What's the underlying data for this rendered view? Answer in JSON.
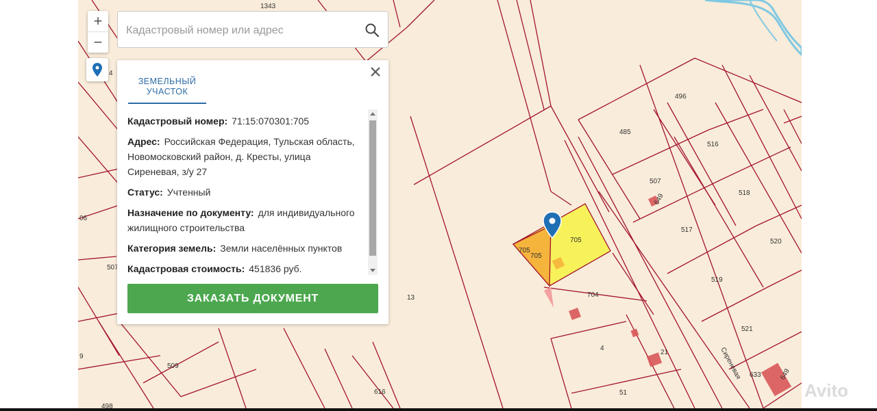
{
  "search": {
    "placeholder": "Кадастровый номер или адрес"
  },
  "zoom": {
    "in_label": "+",
    "out_label": "−"
  },
  "panel": {
    "tab_label": "ЗЕМЕЛЬНЫЙ УЧАСТОК",
    "fields": [
      {
        "label": "Кадастровый номер:",
        "value": "71:15:070301:705"
      },
      {
        "label": "Адрес:",
        "value": "Российская Федерация, Тульская область, Новомосковский район, д. Кресты, улица Сиреневая, з/у 27"
      },
      {
        "label": "Статус:",
        "value": "Учтенный"
      },
      {
        "label": "Назначение по документу:",
        "value": "для индивидуального жилищного строительства"
      },
      {
        "label": "Категория земель:",
        "value": "Земли населённых пунктов"
      },
      {
        "label": "Кадастровая стоимость:",
        "value": "451836 руб."
      }
    ],
    "order_button": "ЗАКАЗАТЬ ДОКУМЕНТ"
  },
  "map": {
    "parcel_labels": [
      "1343",
      "4",
      "06",
      "507",
      "9",
      "509",
      "498",
      "616",
      "13",
      "705",
      "705",
      "705",
      "704",
      "4",
      "51",
      "21",
      "485",
      "496",
      "516",
      "507",
      "518",
      "517",
      "520",
      "519",
      "521",
      "633",
      "649",
      "649"
    ],
    "street_label": "Сиреневая",
    "colors": {
      "background": "#f9ecda",
      "boundary": "#a3142c",
      "selected_fill": "#f7f25a",
      "selected_secondary": "#f5b43c",
      "building": "#d9575a",
      "water": "#7ec8e3",
      "pin": "#1f6fb5"
    }
  },
  "watermark": "Avito"
}
